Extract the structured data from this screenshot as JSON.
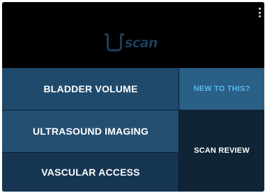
{
  "header": {
    "logo_text": "scan",
    "logo_icon": "u-logo-icon",
    "menu_icon": "more-vertical-icon"
  },
  "tiles": {
    "bladder_volume": "BLADDER VOLUME",
    "ultrasound_imaging": "ULTRASOUND IMAGING",
    "vascular_access": "VASCULAR ACCESS",
    "new_to_this": "NEW TO THIS?",
    "scan_review": "SCAN REVIEW"
  },
  "colors": {
    "background": "#000000",
    "logo": "#1e3d5c",
    "accent_text": "#57b8ef",
    "tile_primary": "#1f4a6b",
    "tile_dark": "#0f2436"
  }
}
